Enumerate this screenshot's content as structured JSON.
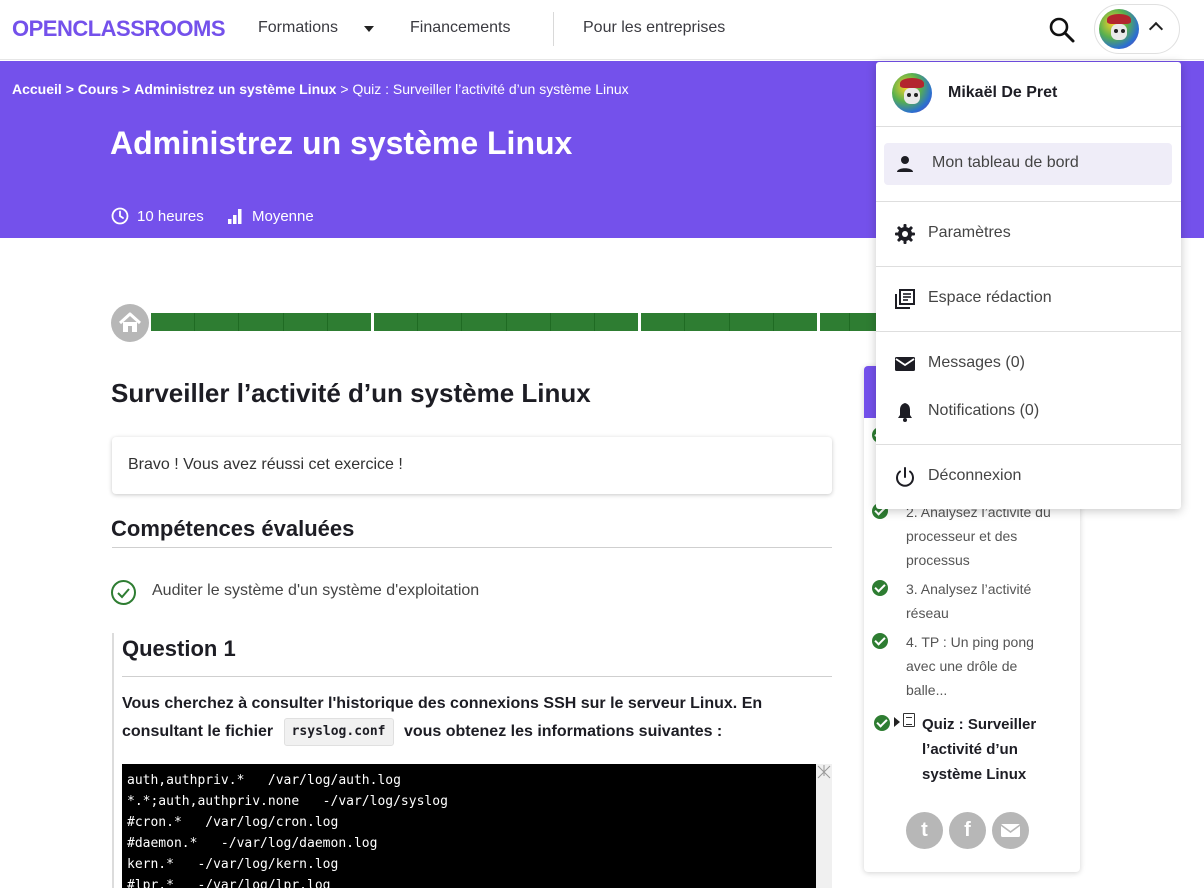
{
  "brand": {
    "logo_text": "OPENCLASSROOMS",
    "accent": "#7451eb",
    "success": "#2e7d32"
  },
  "nav": {
    "formations": "Formations",
    "financements": "Financements",
    "entreprises": "Pour les entreprises"
  },
  "hero": {
    "breadcrumb": {
      "home": "Accueil",
      "sep": ">",
      "courses": "Cours",
      "course": "Administrez un système Linux",
      "current": "Quiz : Surveiller l’activité d’un système Linux"
    },
    "title": "Administrez un système Linux",
    "duration": "10 heures",
    "level": "Moyenne"
  },
  "main": {
    "title": "Surveiller l’activité d’un système Linux",
    "success_message": "Bravo ! Vous avez réussi cet exercice !",
    "skills_heading": "Compétences évaluées",
    "skill": "Auditer le système d'un système d'exploitation",
    "question": {
      "title": "Question 1",
      "text_before": "Vous cherchez à consulter l'historique des connexions SSH sur le serveur Linux. En consultant le fichier",
      "code_inline": "rsyslog.conf",
      "text_after": "vous obtenez les informations suivantes :",
      "code_lines": [
        "auth,authpriv.*   /var/log/auth.log",
        "*.*;auth,authpriv.none   -/var/log/syslog",
        "#cron.*   /var/log/cron.log",
        "#daemon.*   -/var/log/daemon.log",
        "kern.*   -/var/log/kern.log",
        "#lpr.*   -/var/log/lpr.log"
      ]
    }
  },
  "sidebar": {
    "items": [
      {
        "label": "2. Analysez l’activité du processeur et des processus"
      },
      {
        "label": "3. Analysez l’activité réseau"
      },
      {
        "label": "4. TP : Un ping pong avec une drôle de balle..."
      }
    ],
    "current": "Quiz : Surveiller l’activité d’un système Linux",
    "share": {
      "twitter": "t",
      "facebook": "f"
    }
  },
  "user_menu": {
    "name": "Mikaël De Pret",
    "items": [
      {
        "label": "Mon tableau de bord",
        "icon": "person-icon"
      },
      {
        "label": "Paramètres",
        "icon": "gear-icon"
      },
      {
        "label": "Espace rédaction",
        "icon": "library-icon"
      },
      {
        "label": "Messages (0)",
        "icon": "mail-icon"
      },
      {
        "label": "Notifications (0)",
        "icon": "bell-icon"
      },
      {
        "label": "Déconnexion",
        "icon": "power-icon"
      }
    ]
  }
}
